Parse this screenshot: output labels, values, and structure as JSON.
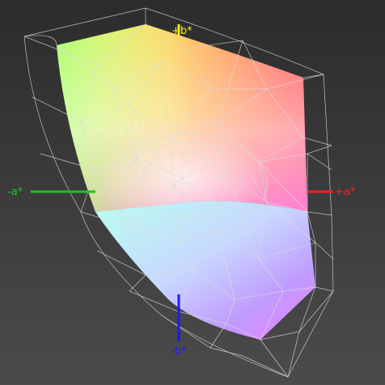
{
  "labels": {
    "pos_b": "+b*",
    "pos_a": "+a*",
    "neg_a": "-a*",
    "neg_b": "-b*"
  },
  "colors": {
    "background_top": "#2e2e2e",
    "background_bottom": "#4a4a4a",
    "pos_b": "#f5f000",
    "pos_a": "#ff2020",
    "neg_a": "#20c020",
    "neg_b": "#1a1aff",
    "wireframe": "#e0e0e0"
  }
}
